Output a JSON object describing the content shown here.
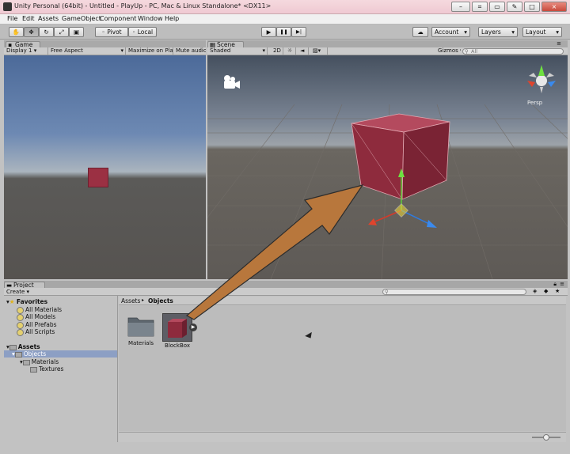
{
  "window": {
    "title": "Unity Personal (64bit) - Untitled - PlayUp - PC, Mac & Linux Standalone* <DX11>",
    "controls": [
      "–",
      "□",
      "×"
    ]
  },
  "menubar": [
    "File",
    "Edit",
    "Assets",
    "GameObject",
    "Component",
    "Window",
    "Help"
  ],
  "toolbar": {
    "tools": [
      "hand-icon",
      "move-icon",
      "rotate-icon",
      "scale-icon",
      "rect-icon"
    ],
    "pivot_label": "Pivot",
    "local_label": "Local",
    "play": "▶",
    "pause": "❚❚",
    "step": "▶|",
    "account_label": "Account",
    "layers_label": "Layers",
    "layout_label": "Layout"
  },
  "game_panel": {
    "tab_label": "Game",
    "display_label": "Display 1",
    "aspect_label": "Free Aspect",
    "maximize_label": "Maximize on Play",
    "mute_label": "Mute audio"
  },
  "scene_panel": {
    "tab_label": "Scene",
    "shading_label": "Shaded",
    "mode_2d_label": "2D",
    "gizmos_label": "Gizmos",
    "search_placeholder": "All",
    "persp_label": "Persp"
  },
  "project_panel": {
    "tab_label": "Project",
    "create_label": "Create",
    "favorites_label": "Favorites",
    "favorites": [
      "All Materials",
      "All Models",
      "All Prefabs",
      "All Scripts"
    ],
    "assets_label": "Assets",
    "tree": [
      {
        "label": "Objects",
        "level": 1,
        "selected": true
      },
      {
        "label": "Materials",
        "level": 2,
        "selected": false
      },
      {
        "label": "Textures",
        "level": 3,
        "selected": false
      }
    ],
    "breadcrumb": [
      "Assets",
      "Objects"
    ],
    "assets": [
      {
        "label": "Materials",
        "kind": "folder"
      },
      {
        "label": "BlockBox",
        "kind": "prefab"
      }
    ]
  },
  "colors": {
    "selection": "#8c9fc4",
    "arrow_fill": "#b8773c",
    "cube": "#9c3244"
  }
}
